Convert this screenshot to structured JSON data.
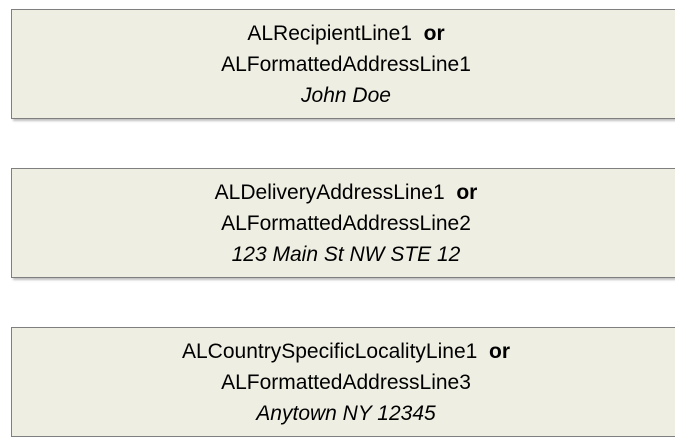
{
  "boxes": [
    {
      "primary_field": "ALRecipientLine1",
      "connector": "or",
      "alternate_field": "ALFormattedAddressLine1",
      "example": "John Doe"
    },
    {
      "primary_field": "ALDeliveryAddressLine1",
      "connector": "or",
      "alternate_field": "ALFormattedAddressLine2",
      "example": "123 Main St NW STE 12"
    },
    {
      "primary_field": "ALCountrySpecificLocalityLine1",
      "connector": "or",
      "alternate_field": "ALFormattedAddressLine3",
      "example": "Anytown NY 12345"
    }
  ],
  "colors": {
    "box_fill": "#eeeee2",
    "box_border": "#7f7f7f",
    "text": "#000000"
  }
}
